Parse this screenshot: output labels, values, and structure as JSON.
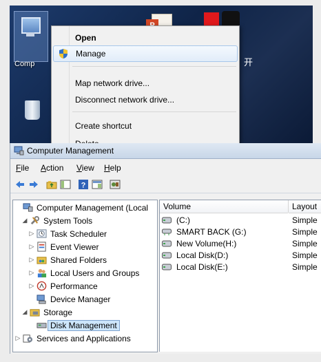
{
  "desktop": {
    "computer_label": "Comp",
    "glyph": "开"
  },
  "context_menu": {
    "items": [
      {
        "label": "Open",
        "bold": true
      },
      {
        "label": "Manage",
        "highlighted": true,
        "icon": "shield-icon"
      },
      {
        "label": "Map network drive..."
      },
      {
        "label": "Disconnect network drive..."
      },
      {
        "label": "Create shortcut"
      },
      {
        "label": "Delete"
      }
    ]
  },
  "window": {
    "title": "Computer Management",
    "menu": [
      {
        "label": "File",
        "accel": "F"
      },
      {
        "label": "Action",
        "accel": "A"
      },
      {
        "label": "View",
        "accel": "V"
      },
      {
        "label": "Help",
        "accel": "H"
      }
    ],
    "toolbar_icons": [
      "back-arrow-icon",
      "forward-arrow-icon",
      "up-folder-icon",
      "show-hide-tree-icon",
      "help-icon",
      "properties-icon",
      "extra-tool-icon"
    ],
    "tree": [
      {
        "label": "Computer Management (Local",
        "level": 0,
        "arrow": "",
        "icon": "computer-management-icon"
      },
      {
        "label": "System Tools",
        "level": 1,
        "arrow": "◢",
        "icon": "system-tools-icon"
      },
      {
        "label": "Task Scheduler",
        "level": 2,
        "arrow": "▷",
        "icon": "task-scheduler-icon"
      },
      {
        "label": "Event Viewer",
        "level": 2,
        "arrow": "▷",
        "icon": "event-viewer-icon"
      },
      {
        "label": "Shared Folders",
        "level": 2,
        "arrow": "▷",
        "icon": "shared-folders-icon"
      },
      {
        "label": "Local Users and Groups",
        "level": 2,
        "arrow": "▷",
        "icon": "users-groups-icon"
      },
      {
        "label": "Performance",
        "level": 2,
        "arrow": "▷",
        "icon": "performance-icon"
      },
      {
        "label": "Device Manager",
        "level": 2,
        "arrow": "",
        "icon": "device-manager-icon"
      },
      {
        "label": "Storage",
        "level": 1,
        "arrow": "◢",
        "icon": "storage-icon"
      },
      {
        "label": "Disk Management",
        "level": 2,
        "arrow": "",
        "icon": "disk-management-icon",
        "selected": true
      },
      {
        "label": "Services and Applications",
        "level": 1,
        "arrow": "▷",
        "icon": "services-icon"
      }
    ],
    "columns": {
      "volume": "Volume",
      "layout": "Layout"
    },
    "volumes": [
      {
        "name": "(C:)",
        "layout": "Simple"
      },
      {
        "name": "SMART BACK (G:)",
        "layout": "Simple"
      },
      {
        "name": "New Volume(H:)",
        "layout": "Simple"
      },
      {
        "name": "Local Disk(D:)",
        "layout": "Simple"
      },
      {
        "name": "Local Disk(E:)",
        "layout": "Simple"
      }
    ]
  }
}
